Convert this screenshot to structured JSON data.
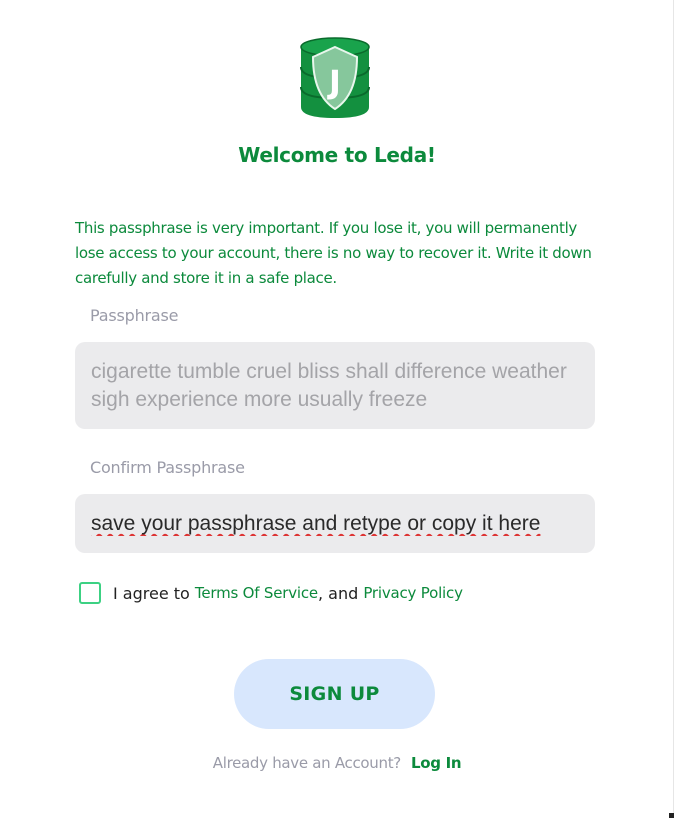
{
  "app": {
    "logo_icon": "shield-database-j-icon",
    "logo_letter": "J",
    "brand_color": "#0c8a3c",
    "title": "Welcome to Leda!"
  },
  "warning_text": "This passphrase is very important. If you lose it, you will permanently lose access to your account, there is no way to recover it. Write it down carefully and store it in a safe place.",
  "passphrase": {
    "label": "Passphrase",
    "value": "cigarette tumble cruel bliss shall difference weather sigh experience more usually freeze"
  },
  "confirm": {
    "label": "Confirm Passphrase",
    "placeholder": "save your passphrase and retype or copy it here"
  },
  "agreement": {
    "checked": false,
    "prefix": "I agree to ",
    "terms_label": "Terms Of Service",
    "separator": ", and ",
    "privacy_label": "Privacy Policy"
  },
  "signup_label": "SIGN UP",
  "footer": {
    "question": "Already have an Account?",
    "login_label": "Log In"
  }
}
